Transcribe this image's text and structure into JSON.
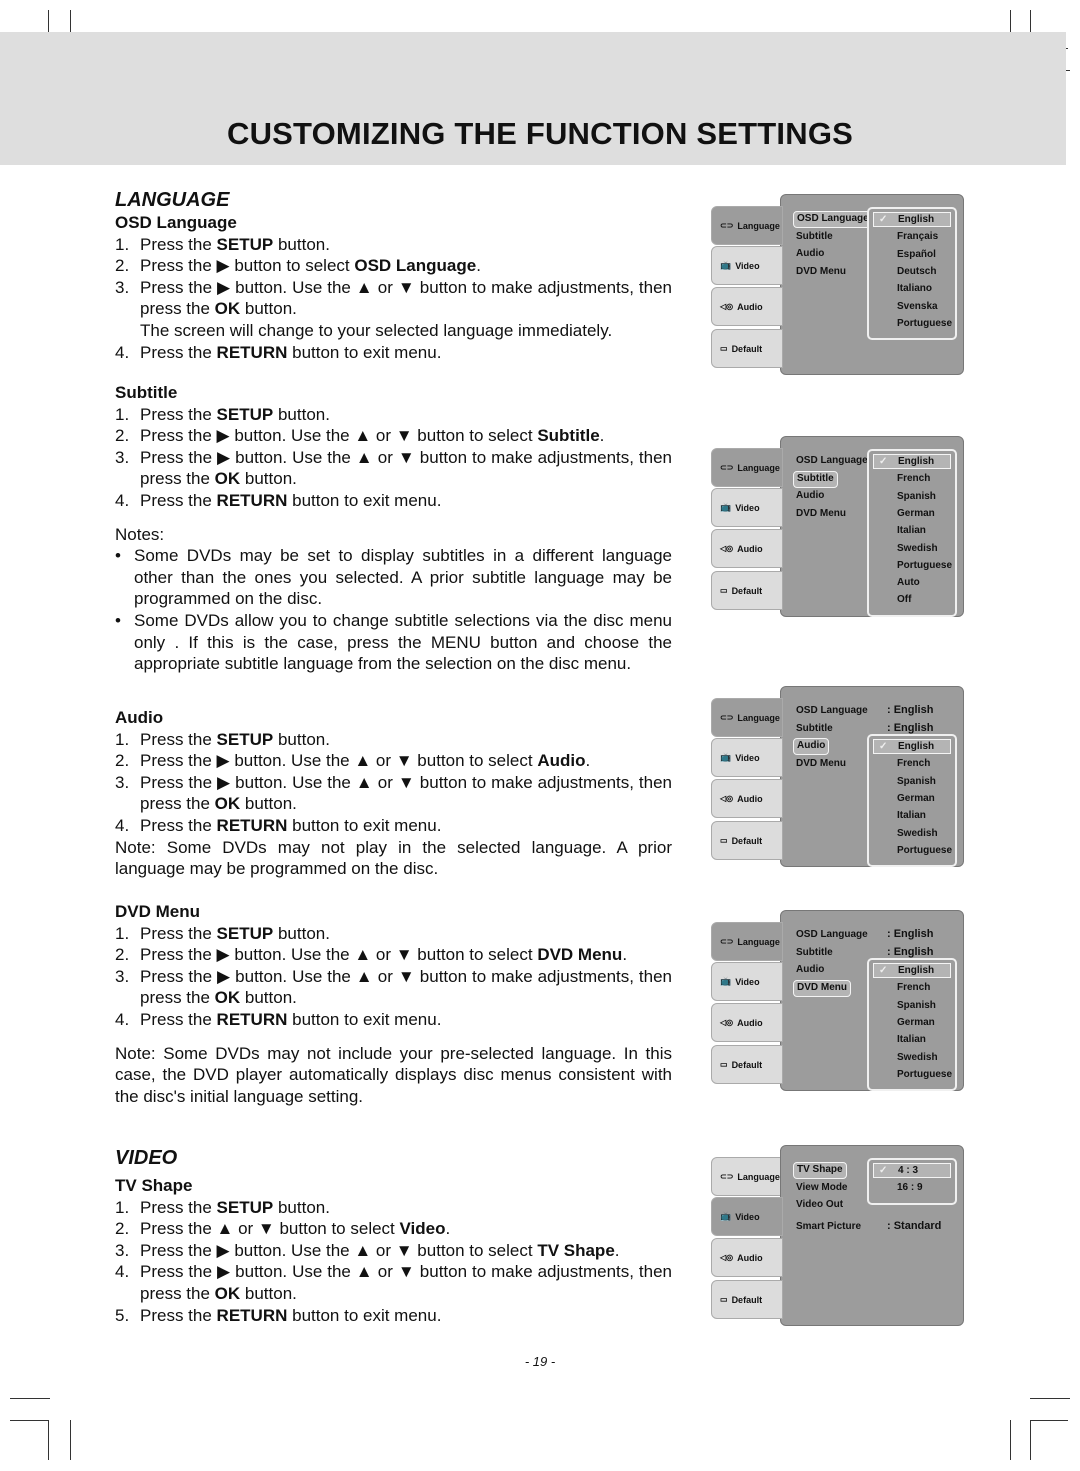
{
  "header": {
    "title": "CUSTOMIZING THE FUNCTION SETTINGS"
  },
  "sections": [
    {
      "title": "LANGUAGE",
      "subtitle": "OSD Language",
      "blocks": [
        {
          "type": "step",
          "n": "1.",
          "segs": [
            {
              "t": "Press the "
            },
            {
              "t": "SETUP",
              "b": true
            },
            {
              "t": " button."
            }
          ]
        },
        {
          "type": "step",
          "n": "2.",
          "segs": [
            {
              "t": "Press the ▶ button to select "
            },
            {
              "t": "OSD Language",
              "b": true
            },
            {
              "t": "."
            }
          ]
        },
        {
          "type": "step",
          "n": "3.",
          "segs": [
            {
              "t": "Press the ▶ button. Use the ▲ or ▼ button to make adjustments, then press the "
            },
            {
              "t": "OK",
              "b": true
            },
            {
              "t": " button."
            }
          ]
        },
        {
          "type": "step",
          "n": "",
          "segs": [
            {
              "t": "The screen will change to your selected language immediately."
            }
          ]
        },
        {
          "type": "step",
          "n": "4.",
          "segs": [
            {
              "t": "Press the "
            },
            {
              "t": "RETURN",
              "b": true
            },
            {
              "t": " button to exit menu."
            }
          ]
        }
      ]
    },
    {
      "title": "",
      "subtitle": "Subtitle",
      "blocks": [
        {
          "type": "step",
          "n": "1.",
          "segs": [
            {
              "t": "Press the "
            },
            {
              "t": "SETUP",
              "b": true
            },
            {
              "t": " button."
            }
          ]
        },
        {
          "type": "step",
          "n": "2.",
          "segs": [
            {
              "t": "Press the ▶ button. Use the ▲ or ▼ button to select "
            },
            {
              "t": "Subtitle",
              "b": true
            },
            {
              "t": "."
            }
          ]
        },
        {
          "type": "step",
          "n": "3.",
          "segs": [
            {
              "t": "Press the ▶ button. Use the ▲ or ▼ button to make adjustments, then press the "
            },
            {
              "t": "OK",
              "b": true
            },
            {
              "t": " button."
            }
          ]
        },
        {
          "type": "step",
          "n": "4.",
          "segs": [
            {
              "t": "Press the "
            },
            {
              "t": "RETURN",
              "b": true
            },
            {
              "t": " button to exit menu."
            }
          ]
        },
        {
          "type": "gap"
        },
        {
          "type": "para",
          "segs": [
            {
              "t": "Notes:"
            }
          ]
        },
        {
          "type": "bullet",
          "n": "•",
          "segs": [
            {
              "t": "Some DVDs may be set to display subtitles in a different language other than the ones you selected. A prior subtitle language may be programmed on the disc."
            }
          ]
        },
        {
          "type": "bullet",
          "n": "•",
          "segs": [
            {
              "t": "Some DVDs allow you to change subtitle selections via the disc menu only . If this is the case, press the MENU button and choose the appropriate subtitle language from the selection on the disc menu."
            }
          ]
        }
      ]
    },
    {
      "title": "",
      "subtitle": "Audio",
      "blocks": [
        {
          "type": "step",
          "n": "1.",
          "segs": [
            {
              "t": "Press the "
            },
            {
              "t": "SETUP",
              "b": true
            },
            {
              "t": " button."
            }
          ]
        },
        {
          "type": "step",
          "n": "2.",
          "segs": [
            {
              "t": "Press the ▶ button. Use the ▲ or ▼ button to select "
            },
            {
              "t": "Audio",
              "b": true
            },
            {
              "t": "."
            }
          ]
        },
        {
          "type": "step",
          "n": "3.",
          "segs": [
            {
              "t": "Press the ▶ button. Use the ▲ or ▼ button to make adjustments, then press the "
            },
            {
              "t": "OK",
              "b": true
            },
            {
              "t": " button."
            }
          ]
        },
        {
          "type": "step",
          "n": "4.",
          "segs": [
            {
              "t": "Press the "
            },
            {
              "t": "RETURN",
              "b": true
            },
            {
              "t": " button to exit menu."
            }
          ]
        },
        {
          "type": "para",
          "segs": [
            {
              "t": "Note: Some DVDs may not  play in the selected language. A prior language may be programmed on the disc."
            }
          ]
        }
      ]
    },
    {
      "title": "",
      "subtitle": "DVD Menu",
      "blocks": [
        {
          "type": "step",
          "n": "1.",
          "segs": [
            {
              "t": "Press the "
            },
            {
              "t": "SETUP",
              "b": true
            },
            {
              "t": " button."
            }
          ]
        },
        {
          "type": "step",
          "n": "2.",
          "segs": [
            {
              "t": "Press the ▶ button. Use the ▲ or ▼ button to select "
            },
            {
              "t": "DVD Menu",
              "b": true
            },
            {
              "t": "."
            }
          ]
        },
        {
          "type": "step",
          "n": "3.",
          "segs": [
            {
              "t": "Press the ▶ button. Use the ▲ or ▼ button to make adjustments, then press the "
            },
            {
              "t": "OK",
              "b": true
            },
            {
              "t": " button."
            }
          ]
        },
        {
          "type": "step",
          "n": "4.",
          "segs": [
            {
              "t": "Press the "
            },
            {
              "t": "RETURN",
              "b": true
            },
            {
              "t": " button to exit menu."
            }
          ]
        },
        {
          "type": "gap"
        },
        {
          "type": "para",
          "segs": [
            {
              "t": "Note: Some DVDs may not include your pre-selected language. In this case, the DVD player automatically displays disc menus consistent with the disc's initial language setting."
            }
          ]
        }
      ]
    },
    {
      "title": "VIDEO",
      "subtitle": "TV Shape",
      "blocks": [
        {
          "type": "step",
          "n": "1.",
          "segs": [
            {
              "t": "Press the "
            },
            {
              "t": "SETUP",
              "b": true
            },
            {
              "t": " button."
            }
          ]
        },
        {
          "type": "step",
          "n": "2.",
          "segs": [
            {
              "t": "Press the ▲ or ▼ button to select "
            },
            {
              "t": "Video",
              "b": true
            },
            {
              "t": "."
            }
          ]
        },
        {
          "type": "step",
          "n": "3.",
          "segs": [
            {
              "t": "Press the ▶ button. Use the ▲ or ▼ button to select "
            },
            {
              "t": "TV Shape",
              "b": true
            },
            {
              "t": "."
            }
          ]
        },
        {
          "type": "step",
          "n": "4.",
          "segs": [
            {
              "t": "Press the ▶ button. Use the ▲ or ▼ button to make adjustments, then press the "
            },
            {
              "t": "OK",
              "b": true
            },
            {
              "t": " button."
            }
          ]
        },
        {
          "type": "step",
          "n": "5.",
          "segs": [
            {
              "t": "Press the "
            },
            {
              "t": "RETURN",
              "b": true
            },
            {
              "t": " button to exit menu."
            }
          ]
        }
      ]
    }
  ],
  "menus": [
    {
      "tabs": [
        {
          "label": "Language",
          "icon": "lips-icon"
        },
        {
          "label": "Video",
          "icon": "tv-icon"
        },
        {
          "label": "Audio",
          "icon": "speaker-icon"
        },
        {
          "label": "Default",
          "icon": "keyboard-icon"
        }
      ],
      "active_tab": 0,
      "items": [
        "OSD Language",
        "Subtitle",
        "Audio",
        "DVD Menu"
      ],
      "active_item": 0,
      "values": [],
      "options": [
        "English",
        "Français",
        "Español",
        "Deutsch",
        "Italiano",
        "Svenska",
        "Portuguese"
      ],
      "checked": 0
    },
    {
      "tabs": [
        {
          "label": "Language",
          "icon": "lips-icon"
        },
        {
          "label": "Video",
          "icon": "tv-icon"
        },
        {
          "label": "Audio",
          "icon": "speaker-icon"
        },
        {
          "label": "Default",
          "icon": "keyboard-icon"
        }
      ],
      "active_tab": 0,
      "items": [
        "OSD Language",
        "Subtitle",
        "Audio",
        "DVD Menu"
      ],
      "active_item": 1,
      "values": [],
      "options": [
        "English",
        "French",
        "Spanish",
        "German",
        "Italian",
        "Swedish",
        "Portuguese",
        "Auto",
        "Off"
      ],
      "checked": 0,
      "popup_from_top": true
    },
    {
      "tabs": [
        {
          "label": "Language",
          "icon": "lips-icon"
        },
        {
          "label": "Video",
          "icon": "tv-icon"
        },
        {
          "label": "Audio",
          "icon": "speaker-icon"
        },
        {
          "label": "Default",
          "icon": "keyboard-icon"
        }
      ],
      "active_tab": 0,
      "items": [
        "OSD Language",
        "Subtitle",
        "Audio",
        "DVD Menu"
      ],
      "active_item": 2,
      "values": [
        ": English",
        ": English"
      ],
      "options": [
        "English",
        "French",
        "Spanish",
        "German",
        "Italian",
        "Swedish",
        "Portuguese"
      ],
      "checked": 0
    },
    {
      "tabs": [
        {
          "label": "Language",
          "icon": "lips-icon"
        },
        {
          "label": "Video",
          "icon": "tv-icon"
        },
        {
          "label": "Audio",
          "icon": "speaker-icon"
        },
        {
          "label": "Default",
          "icon": "keyboard-icon"
        }
      ],
      "active_tab": 0,
      "items": [
        "OSD Language",
        "Subtitle",
        "Audio",
        "DVD Menu"
      ],
      "active_item": 3,
      "values": [
        ": English",
        ": English"
      ],
      "options": [
        "English",
        "French",
        "Spanish",
        "German",
        "Italian",
        "Swedish",
        "Portuguese"
      ],
      "checked": 0,
      "popup_row": 2
    },
    {
      "tabs": [
        {
          "label": "Language",
          "icon": "lips-icon"
        },
        {
          "label": "Video",
          "icon": "tv-icon"
        },
        {
          "label": "Audio",
          "icon": "speaker-icon"
        },
        {
          "label": "Default",
          "icon": "keyboard-icon"
        }
      ],
      "active_tab": 1,
      "items": [
        "TV Shape",
        "View Mode",
        "Video Out",
        "Smart Picture"
      ],
      "active_item": 0,
      "values": [
        "",
        "",
        "",
        ": Standard"
      ],
      "options": [
        "4 : 3",
        "16 : 9"
      ],
      "checked": 0
    }
  ],
  "footer": {
    "page_number": "- 19 -"
  }
}
